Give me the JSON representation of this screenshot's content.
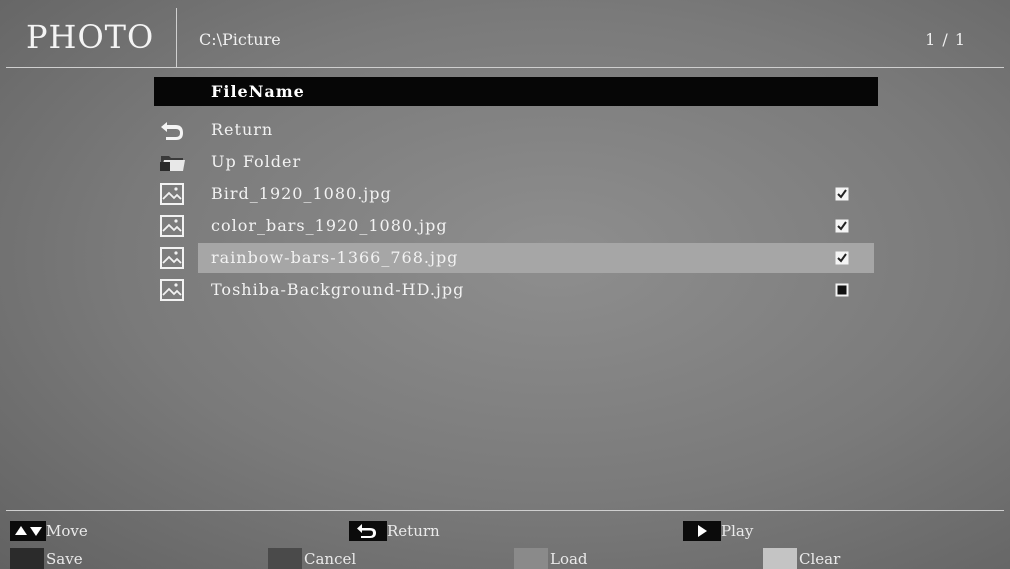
{
  "header": {
    "app_title": "PHOTO",
    "path": "C:\\Picture",
    "page_count": "1 / 1"
  },
  "file_list": {
    "column_header": "FileName",
    "items": [
      {
        "label": "Return",
        "icon": "return-icon",
        "checkbox": null
      },
      {
        "label": "Up Folder",
        "icon": "folder-icon",
        "checkbox": null
      },
      {
        "label": "Bird_1920_1080.jpg",
        "icon": "image-icon",
        "checked": true
      },
      {
        "label": "color_bars_1920_1080.jpg",
        "icon": "image-icon",
        "checked": true
      },
      {
        "label": "rainbow-bars-1366_768.jpg",
        "icon": "image-icon",
        "checked": true,
        "selected": true
      },
      {
        "label": "Toshiba-Background-HD.jpg",
        "icon": "image-icon",
        "checked": false
      }
    ]
  },
  "footer": {
    "move_label": "Move",
    "return_label": "Return",
    "play_label": "Play",
    "save_label": "Save",
    "cancel_label": "Cancel",
    "load_label": "Load",
    "clear_label": "Clear",
    "key_colors": {
      "save": "#2b2b2b",
      "cancel": "#4a4a4a",
      "load": "#8a8a8a",
      "clear": "#c4c4c4"
    }
  }
}
